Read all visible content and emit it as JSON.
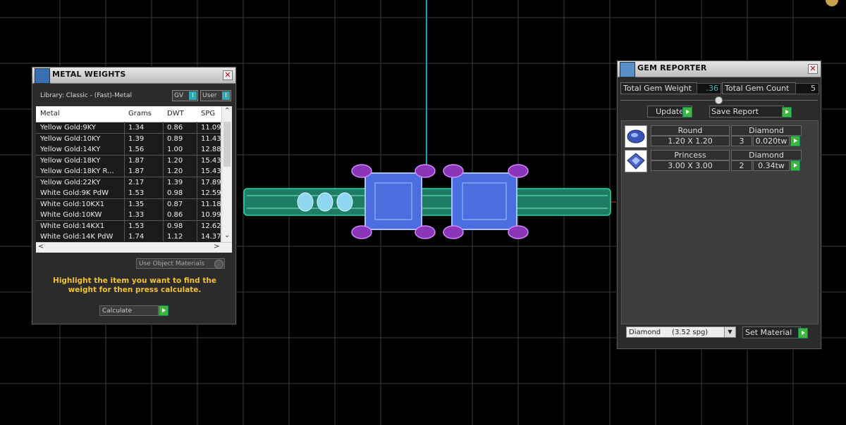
{
  "metal_weights": {
    "title": "METAL WEIGHTS",
    "library_label": "Library: Classic - (Fast)-Metal",
    "toggle_gv": "GV",
    "toggle_user": "User",
    "columns": [
      "Metal",
      "Grams",
      "DWT",
      "SPG"
    ],
    "rows": [
      {
        "metal": "Yellow Gold:9KY",
        "grams": "1.34",
        "dwt": "0.86",
        "spg": "11.09"
      },
      {
        "metal": "Yellow Gold:10KY",
        "grams": "1.39",
        "dwt": "0.89",
        "spg": "11.43"
      },
      {
        "metal": "Yellow Gold:14KY",
        "grams": "1.56",
        "dwt": "1.00",
        "spg": "12.88"
      },
      {
        "metal": "Yellow Gold:18KY",
        "grams": "1.87",
        "dwt": "1.20",
        "spg": "15.43"
      },
      {
        "metal": "Yellow Gold:18KY R...",
        "grams": "1.87",
        "dwt": "1.20",
        "spg": "15.43"
      },
      {
        "metal": "Yellow Gold:22KY",
        "grams": "2.17",
        "dwt": "1.39",
        "spg": "17.89"
      },
      {
        "metal": "White Gold:9K PdW",
        "grams": "1.53",
        "dwt": "0.98",
        "spg": "12.59"
      },
      {
        "metal": "White Gold:10KX1",
        "grams": "1.35",
        "dwt": "0.87",
        "spg": "11.18"
      },
      {
        "metal": "White Gold:10KW",
        "grams": "1.33",
        "dwt": "0.86",
        "spg": "10.99"
      },
      {
        "metal": "White Gold:14KX1",
        "grams": "1.53",
        "dwt": "0.98",
        "spg": "12.62"
      },
      {
        "metal": "White Gold:14K PdW",
        "grams": "1.74",
        "dwt": "1.12",
        "spg": "14.37"
      }
    ],
    "use_object_materials": "Use Object Materials",
    "hint": "Highlight the item you want to find the weight for then press calculate.",
    "calculate": "Calculate"
  },
  "gem_reporter": {
    "title": "GEM REPORTER",
    "total_weight_label": "Total Gem Weight",
    "total_weight_value": ".36",
    "total_count_label": "Total Gem Count",
    "total_count_value": "5",
    "update": "Update",
    "save_report": "Save Report",
    "gems": [
      {
        "shape": "Round",
        "material": "Diamond",
        "size": "1.20 X 1.20",
        "count": "3",
        "weight": "0.020tw"
      },
      {
        "shape": "Princess",
        "material": "Diamond",
        "size": "3.00 X 3.00",
        "count": "2",
        "weight": "0.34tw"
      }
    ],
    "material_select": "Diamond     (3.52 spg)",
    "set_material": "Set Material"
  },
  "colors": {
    "background": "#000000",
    "grid": "#3c3c3c",
    "axis": "#1fa0b5",
    "band": "#2bb39a",
    "gem_blue": "#5a7de0",
    "prong_purple": "#9a3fc6",
    "hint_text": "#f1c232",
    "green_button": "#3fb53f"
  }
}
